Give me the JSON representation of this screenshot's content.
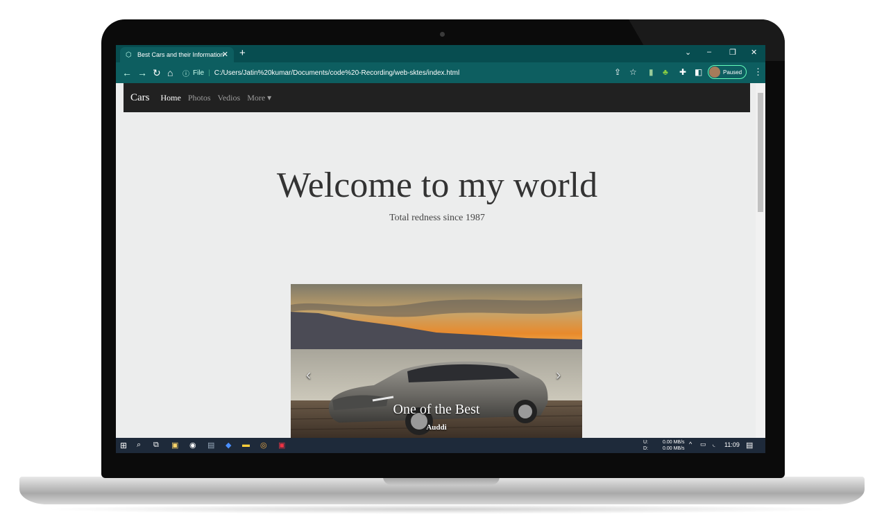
{
  "browser": {
    "tab_title": "Best Cars and their Information",
    "tab_close": "✕",
    "new_tab": "+",
    "url_scheme": "File",
    "url": "C:/Users/Jatin%20kumar/Documents/code%20-Recording/web-sktes/index.html",
    "profile_status": "Paused",
    "window_controls": {
      "dropdown": "⌄",
      "minimize": "–",
      "restore": "❐",
      "close": "✕"
    }
  },
  "navbar": {
    "brand": "Cars",
    "links": [
      {
        "label": "Home",
        "active": true
      },
      {
        "label": "Photos",
        "active": false
      },
      {
        "label": "Vedios",
        "active": false
      },
      {
        "label": "More ▾",
        "active": false
      }
    ]
  },
  "hero": {
    "title": "Welcome to my world",
    "subtitle": "Total redness since 1987"
  },
  "carousel": {
    "caption_title": "One of the Best",
    "caption_subtitle": "Auddi",
    "prev": "‹",
    "next": "›"
  },
  "taskbar": {
    "upload_label": "U:",
    "download_label": "D:",
    "upload_speed": "0.00 MB/s",
    "download_speed": "0.00 MB/s",
    "time": "11:09"
  },
  "colors": {
    "browser_frame": "#074d50",
    "toolbar": "#0d5e60",
    "navbar_bg": "#212121",
    "page_bg": "#eceded",
    "taskbar_bg": "#1e2a3a"
  }
}
